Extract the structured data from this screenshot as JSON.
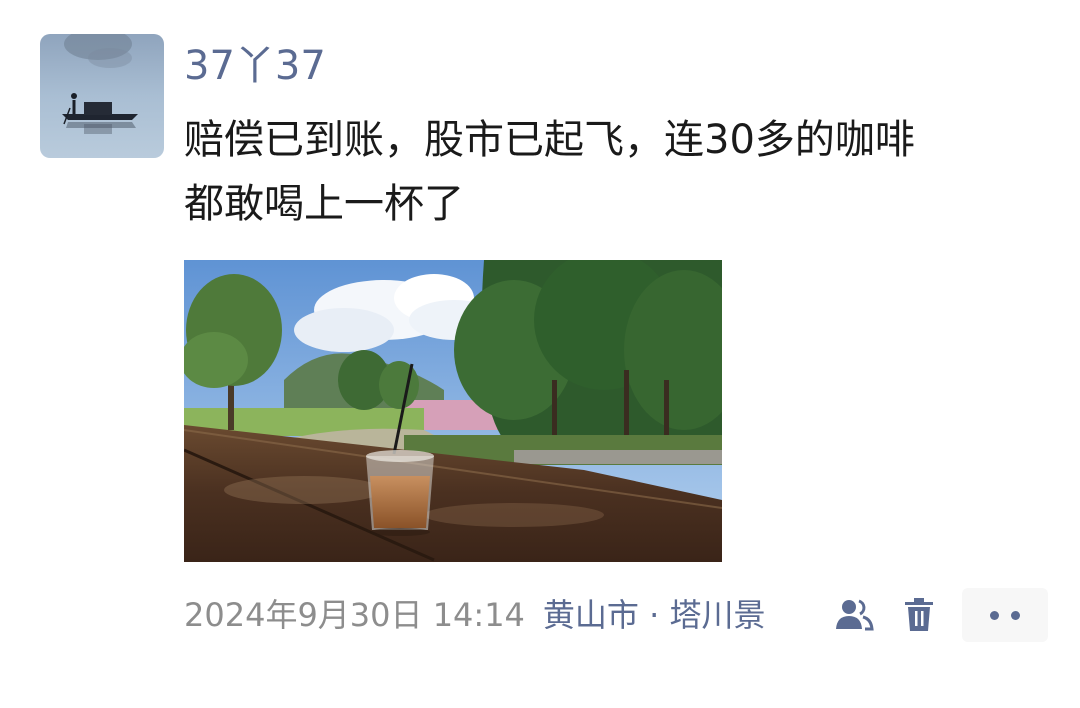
{
  "post": {
    "username": "37丫37",
    "text_lines": [
      "赔偿已到账，股市已起飞，连30多的咖啡",
      "都敢喝上一杯了"
    ],
    "timestamp": "2024年9月30日 14:14",
    "location": "黄山市 · 塔川景"
  },
  "icons": {
    "avatar": "boatman-on-lake-photo",
    "photo": "iced-coffee-on-table-garden-photo",
    "visibility": "people-icon",
    "delete": "trash-icon",
    "more": "more-dots-icon"
  },
  "colors": {
    "link_blue": "#5b6b92",
    "timestamp_gray": "#8d8d8d",
    "text": "#1a1a1a"
  }
}
